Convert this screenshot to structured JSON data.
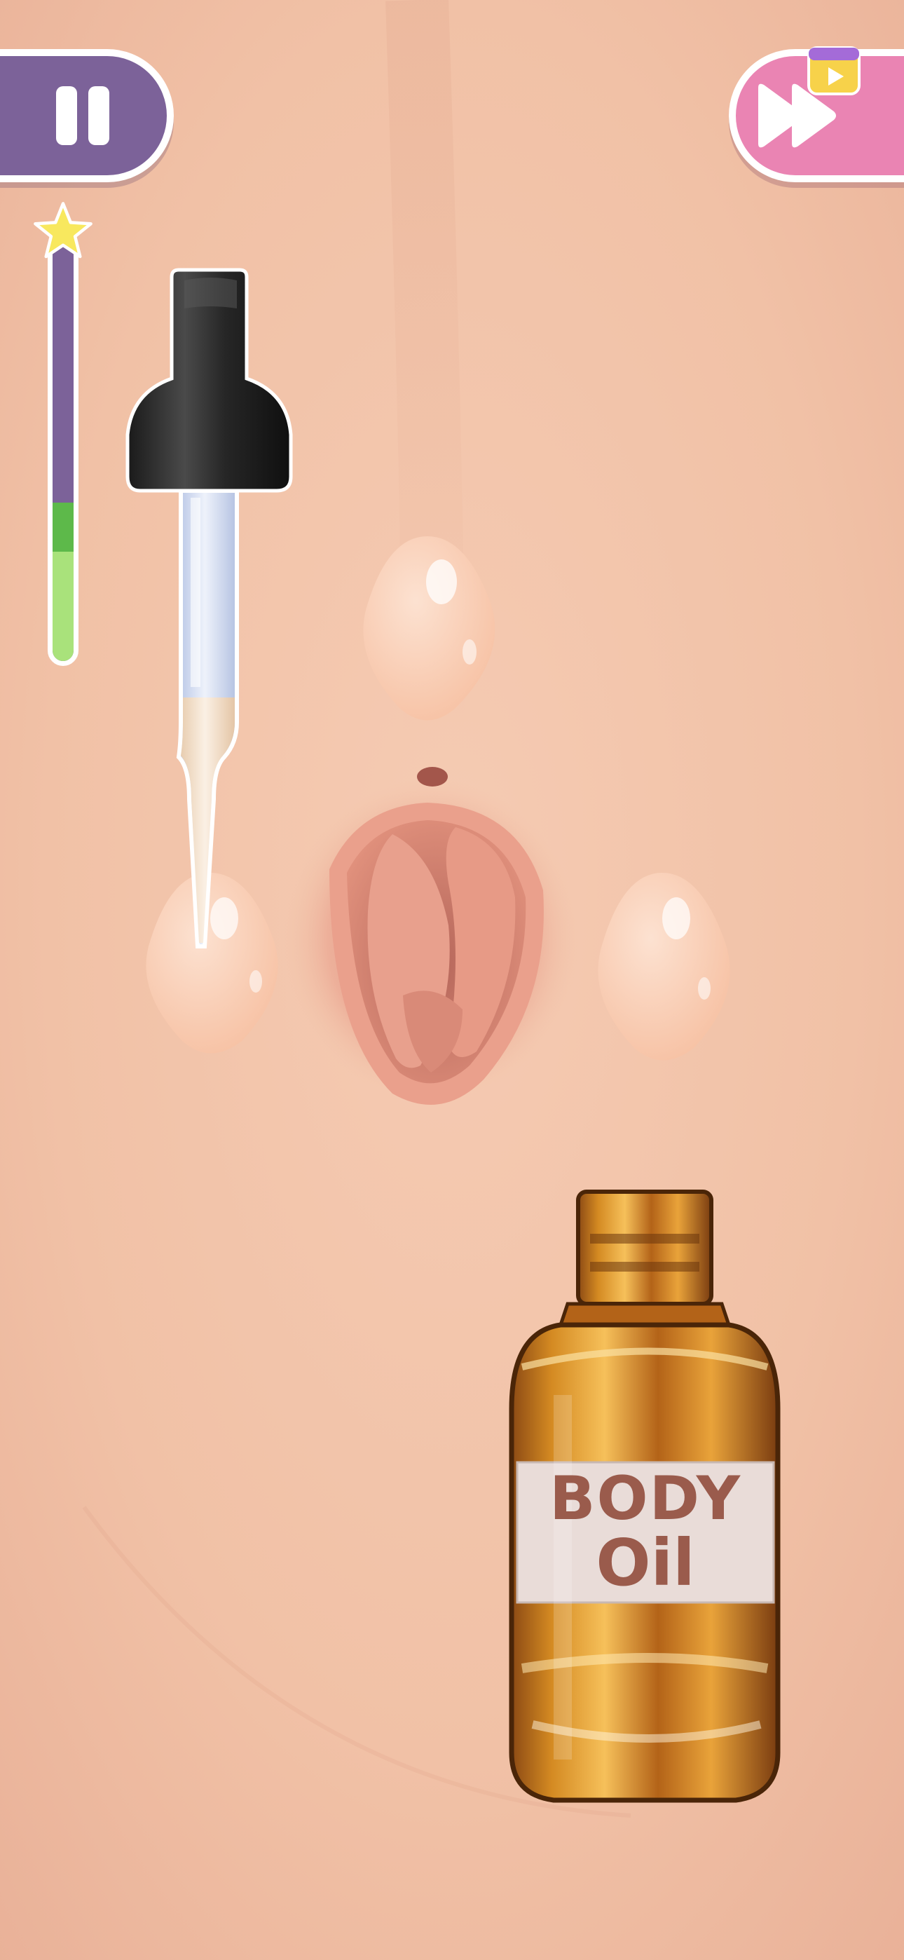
{
  "game": {
    "progress": 0.38,
    "colors": {
      "skin": "#f1c1a6",
      "pause_button": "#7c6299",
      "skip_button": "#ea84b3",
      "progress_fill": "#a9e27b",
      "oil": "#d8891e"
    }
  },
  "bottle": {
    "label_line1": "BODY",
    "label_line2": "Oil"
  },
  "icons": {
    "pause": "pause-icon",
    "skip": "fast-forward-icon",
    "video_ad": "video-ad-icon",
    "star": "star-icon"
  }
}
